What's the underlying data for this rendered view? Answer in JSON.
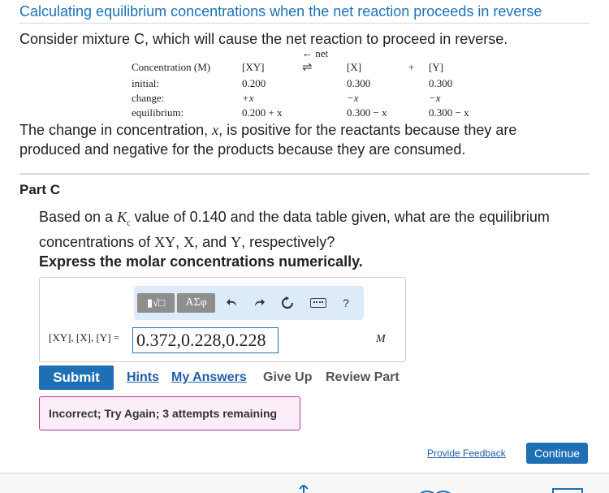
{
  "title": "Calculating equilibrium concentrations when the net reaction proceeds in reverse",
  "intro": "Consider mixture C, which will cause the net reaction to proceed in reverse.",
  "ice_table": {
    "direction_label": "← net",
    "equilibrium_arrow": "⇌",
    "plus": "+",
    "headers": [
      "Concentration (M)",
      "[XY]",
      "[X]",
      "[Y]"
    ],
    "rows": [
      {
        "label": "initial:",
        "xy": "0.200",
        "x": "0.300",
        "y": "0.300"
      },
      {
        "label": "change:",
        "xy": "+x",
        "x": "−x",
        "y": "−x"
      },
      {
        "label": "equilibrium:",
        "xy": "0.200 + x",
        "x": "0.300 − x",
        "y": "0.300 − x"
      }
    ]
  },
  "explanation": {
    "part1": "The change in concentration, ",
    "var": "x",
    "part2": ", is positive for the reactants because they are produced and negative for the products because they are consumed."
  },
  "part": {
    "title": "Part C",
    "question_a": "Based on a ",
    "question_k": "Kc",
    "question_b": " value of 0.140 and the data table given, what are the equilibrium concentrations of ",
    "species_1": "XY",
    "question_sep1": ", ",
    "species_2": "X",
    "question_sep2": ", and ",
    "species_3": "Y",
    "question_end": ", respectively?",
    "instruction": "Express the molar concentrations numerically."
  },
  "toolbar": {
    "templates_label": "▮√□",
    "greek_label": "ΑΣφ",
    "undo_icon": "↶",
    "redo_icon": "↷",
    "reset_icon": "↻",
    "help_label": "?"
  },
  "answer": {
    "label": "[XY], [X], [Y] =",
    "value": "0.372,0.228,0.228",
    "unit": "M"
  },
  "actions": {
    "submit": "Submit",
    "hints": "Hints",
    "my_answers": "My Answers",
    "give_up": "Give Up",
    "review_part": "Review Part"
  },
  "feedback": "Incorrect; Try Again; 3 attempts remaining",
  "footer": {
    "provide_feedback": "Provide Feedback",
    "continue": "Continue"
  },
  "colors": {
    "link_blue": "#1f5fa8",
    "button_blue": "#1f6fb5",
    "title_blue": "#1a73b8",
    "feedback_border": "#b4358a",
    "feedback_bg": "#fbeef8",
    "toolbar_bg": "#ddeaf8"
  }
}
